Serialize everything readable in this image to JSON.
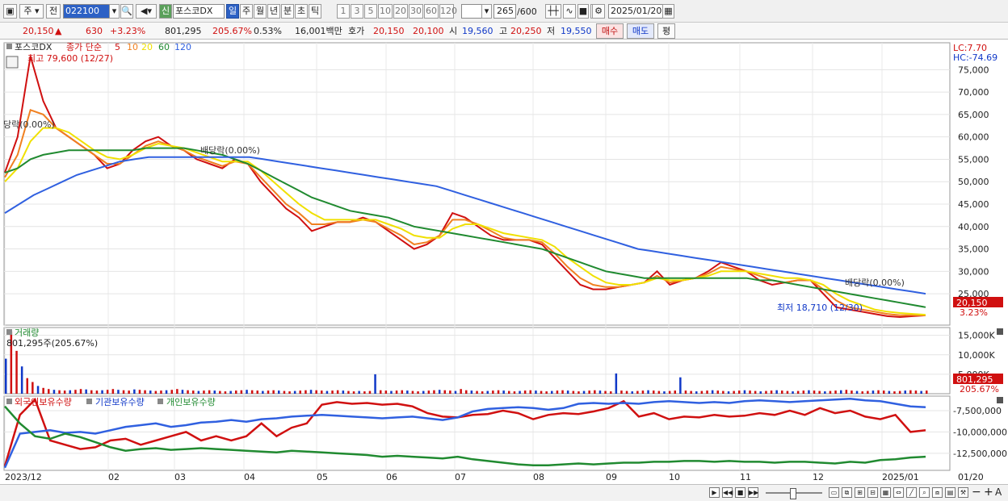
{
  "toolbar": {
    "period_day": "주",
    "prev_label": "전",
    "code": "022100",
    "new_badge": "신",
    "stock_name": "포스코DX",
    "periods": [
      "일",
      "주",
      "월",
      "년",
      "분",
      "초",
      "틱"
    ],
    "selected_period": "일",
    "intervals": [
      "1",
      "3",
      "5",
      "10",
      "20",
      "30",
      "60",
      "120"
    ],
    "count": "265",
    "count_total": "/600",
    "date": "2025/01/20"
  },
  "quote": {
    "price": "20,150",
    "change": "630",
    "change_pct": "+3.23%",
    "volume": "801,295",
    "volume_ratio": "205.67%",
    "turnover": "0.53%",
    "amount": "16,001백만",
    "bid_label": "호가",
    "bid1": "20,150",
    "bid2": "20,100",
    "open_label": "시",
    "open": "19,560",
    "high_label": "고",
    "high": "20,250",
    "low_label": "저",
    "low": "19,550",
    "buy_label": "매수",
    "sell_label": "매도",
    "eval_label": "평"
  },
  "legend": {
    "name": "포스코DX",
    "ma_title": "종가 단순",
    "ma_periods": [
      "5",
      "10",
      "20",
      "60",
      "120"
    ],
    "ma_colors": [
      "#d01010",
      "#f08020",
      "#f0e000",
      "#208a30",
      "#3060e0"
    ],
    "lc": "LC:7.70",
    "hc": "HC:-74.69"
  },
  "annotations": {
    "high_text": "최고 79,600 (12/27)",
    "low_text": "최저 18,710 (12/30)",
    "div1": "당락(0.00%)",
    "div2": "배당락(0.00%)",
    "div3": "배당락(0.00%)",
    "price_tag": "20,150",
    "price_pct_tag": "3.23%"
  },
  "volume_panel": {
    "title": "거래량",
    "value_text": "801,295주(205.67%)",
    "tag_value": "801,295",
    "tag_pct": "205.67%"
  },
  "holdings_panel": {
    "titles": [
      "외국인보유수량",
      "기관보유수량",
      "개인보유수량"
    ]
  },
  "chart_data": [
    {
      "type": "line",
      "title": "포스코DX",
      "x_ticks": [
        "2023/12",
        "02",
        "03",
        "04",
        "05",
        "06",
        "07",
        "08",
        "09",
        "10",
        "11",
        "12",
        "2025/01",
        "01/20"
      ],
      "y_ticks": [
        75000,
        70000,
        65000,
        60000,
        55000,
        50000,
        45000,
        40000,
        35000,
        30000,
        25000
      ],
      "ylim": [
        18000,
        81000
      ],
      "series": [
        {
          "name": "5",
          "color": "#d01010",
          "values": [
            52000,
            60000,
            78000,
            68000,
            62000,
            60000,
            58000,
            56000,
            53000,
            54000,
            57000,
            59000,
            60000,
            58000,
            57000,
            55000,
            54000,
            53000,
            55000,
            54000,
            50000,
            47000,
            44000,
            42000,
            39000,
            40000,
            41000,
            41000,
            42000,
            41000,
            39000,
            37000,
            35000,
            36000,
            38000,
            43000,
            42000,
            40000,
            38000,
            37000,
            37000,
            37000,
            36000,
            33000,
            30000,
            27000,
            26000,
            26000,
            26500,
            27000,
            27500,
            30000,
            27000,
            28000,
            28500,
            30000,
            32000,
            31000,
            30000,
            28000,
            27000,
            27500,
            28000,
            28000,
            25000,
            22000,
            21500,
            21000,
            20500,
            20000,
            19800,
            20000,
            20200
          ]
        },
        {
          "name": "10",
          "color": "#f08020",
          "values": [
            51000,
            56000,
            66000,
            65000,
            62000,
            60000,
            58000,
            56000,
            54000,
            54000,
            56000,
            58000,
            59000,
            58000,
            57000,
            55500,
            54500,
            53500,
            54500,
            54000,
            51000,
            48000,
            45000,
            43000,
            40500,
            40500,
            41000,
            41000,
            41500,
            41000,
            39500,
            38000,
            36000,
            36500,
            38000,
            41500,
            41500,
            40500,
            39000,
            37500,
            37000,
            37000,
            36500,
            34000,
            31000,
            28500,
            27000,
            26500,
            26500,
            27000,
            27500,
            29000,
            27500,
            28000,
            28500,
            29500,
            31000,
            30500,
            30000,
            29000,
            28000,
            27500,
            28000,
            28000,
            26000,
            23500,
            22000,
            21500,
            21000,
            20500,
            20200,
            20200,
            20200
          ]
        },
        {
          "name": "20",
          "color": "#f0e000",
          "values": [
            50000,
            53000,
            59000,
            62000,
            62000,
            61000,
            59000,
            57000,
            55500,
            55000,
            56000,
            57500,
            58500,
            58000,
            57500,
            56500,
            55500,
            54500,
            54500,
            54500,
            52500,
            50000,
            47500,
            45000,
            43000,
            41500,
            41500,
            41500,
            41500,
            41500,
            40500,
            39500,
            38000,
            37500,
            37500,
            39500,
            40500,
            40500,
            39500,
            38500,
            38000,
            37500,
            37000,
            35500,
            33000,
            31000,
            29000,
            27500,
            27000,
            27000,
            27500,
            28500,
            28000,
            28000,
            28500,
            29000,
            30000,
            30000,
            30000,
            29500,
            29000,
            28500,
            28500,
            28000,
            27000,
            25000,
            23500,
            22500,
            21500,
            21000,
            20700,
            20500,
            20300
          ]
        },
        {
          "name": "60",
          "color": "#208a30",
          "values": [
            52000,
            53000,
            55000,
            56000,
            56500,
            57000,
            57000,
            57000,
            57000,
            57000,
            57000,
            57500,
            57500,
            57500,
            57500,
            57000,
            56500,
            56000,
            55000,
            54000,
            52500,
            51000,
            49500,
            48000,
            46500,
            45500,
            44500,
            43500,
            43000,
            42500,
            42000,
            41000,
            40000,
            39500,
            39000,
            38500,
            38000,
            37500,
            37000,
            36500,
            36000,
            35500,
            35000,
            34000,
            33000,
            32000,
            31000,
            30000,
            29500,
            29000,
            28500,
            28500,
            28500,
            28500,
            28500,
            28500,
            28500,
            28500,
            28500,
            28000,
            28000,
            27500,
            27000,
            26500,
            26000,
            25500,
            25000,
            24500,
            24000,
            23500,
            23000,
            22500,
            22000
          ]
        },
        {
          "name": "120",
          "color": "#3060e0",
          "values": [
            43000,
            45000,
            47000,
            48500,
            50000,
            51500,
            52500,
            53500,
            54500,
            55000,
            55500,
            55500,
            55500,
            55500,
            55500,
            55500,
            55500,
            55500,
            55000,
            54500,
            54000,
            53500,
            53000,
            52500,
            52000,
            51500,
            51000,
            50500,
            50000,
            49500,
            49000,
            48000,
            47000,
            46000,
            45000,
            44000,
            43000,
            42000,
            41000,
            40000,
            39000,
            38000,
            37000,
            36000,
            35000,
            34500,
            34000,
            33500,
            33000,
            32500,
            32000,
            31500,
            31000,
            30500,
            30000,
            29500,
            29000,
            28500,
            28000,
            27500,
            27000,
            26500,
            26000,
            25500,
            25000
          ]
        }
      ]
    },
    {
      "type": "bar",
      "title": "거래량",
      "y_ticks": [
        "15,000K",
        "10,000K",
        "5,000K"
      ],
      "ylim": [
        0,
        17000
      ],
      "unit": "K",
      "values": [
        9000,
        16000,
        11000,
        7000,
        4000,
        3000,
        2000,
        1500,
        1200,
        1000,
        900,
        800,
        900,
        1000,
        1200,
        1100,
        900,
        800,
        900,
        1000,
        1200,
        1000,
        900,
        800,
        1100,
        1000,
        900,
        800,
        700,
        800,
        900,
        1000,
        1200,
        1000,
        900,
        800,
        700,
        800,
        900,
        800,
        700,
        600,
        700,
        800,
        900,
        1000,
        900,
        800,
        700,
        800,
        900,
        800,
        700,
        600,
        700,
        800,
        900,
        1000,
        900,
        800,
        700,
        800,
        900,
        800,
        700,
        600,
        700,
        600,
        700,
        5000,
        900,
        800,
        700,
        800,
        900,
        800,
        700,
        600,
        700,
        800,
        900,
        1000,
        900,
        800,
        700,
        1200,
        900,
        800,
        700,
        600,
        700,
        800,
        900,
        800,
        700,
        600,
        700,
        800,
        900,
        800,
        700,
        600,
        700,
        800,
        900,
        800,
        700,
        600,
        700,
        800,
        900,
        800,
        700,
        600,
        5200,
        800,
        700,
        600,
        700,
        800,
        900,
        800,
        700,
        600,
        700,
        800,
        4200,
        800,
        700,
        600,
        700,
        800,
        900,
        800,
        700,
        600,
        700,
        800,
        900,
        800,
        700,
        600,
        700,
        800,
        900,
        800,
        700,
        600,
        700,
        800,
        900,
        800,
        700,
        600,
        700,
        800,
        900,
        1000,
        800,
        700,
        600,
        700,
        800,
        900,
        800,
        700,
        600,
        700,
        800,
        900,
        800,
        700,
        800
      ]
    },
    {
      "type": "line",
      "title": "외국인보유수량",
      "y_ticks": [
        "-7,500,000",
        "-10,000,000",
        "-12,500,000"
      ],
      "ylim": [
        -14500000,
        -5800000
      ],
      "series": [
        {
          "name": "외국인보유수량",
          "color": "#d01010",
          "values": [
            -14000000,
            -8000000,
            -6200000,
            -11000000,
            -11500000,
            -12000000,
            -11800000,
            -11000000,
            -10800000,
            -11500000,
            -11000000,
            -10500000,
            -10000000,
            -11000000,
            -10500000,
            -11000000,
            -10500000,
            -9000000,
            -10500000,
            -9500000,
            -9000000,
            -6800000,
            -6500000,
            -6700000,
            -6600000,
            -6800000,
            -6700000,
            -7000000,
            -7800000,
            -8200000,
            -8300000,
            -8000000,
            -7900000,
            -7500000,
            -7800000,
            -8500000,
            -8000000,
            -7800000,
            -7900000,
            -7600000,
            -7200000,
            -6400000,
            -8200000,
            -7800000,
            -8500000,
            -8200000,
            -8300000,
            -8000000,
            -8200000,
            -8100000,
            -7800000,
            -8000000,
            -7500000,
            -8000000,
            -7200000,
            -7800000,
            -7500000,
            -8200000,
            -8500000,
            -8000000,
            -10000000,
            -9800000
          ]
        },
        {
          "name": "기관보유수량",
          "color": "#3060e0",
          "values": [
            -14200000,
            -10200000,
            -10000000,
            -9800000,
            -10100000,
            -10000000,
            -10200000,
            -9800000,
            -9400000,
            -9200000,
            -9000000,
            -9400000,
            -9200000,
            -8900000,
            -8800000,
            -8600000,
            -8800000,
            -8500000,
            -8400000,
            -8200000,
            -8100000,
            -8000000,
            -8100000,
            -8200000,
            -8300000,
            -8400000,
            -8300000,
            -8200000,
            -8400000,
            -8600000,
            -8300000,
            -7600000,
            -7300000,
            -7200000,
            -7100000,
            -7200000,
            -7400000,
            -7200000,
            -6700000,
            -6600000,
            -6700000,
            -6600000,
            -6700000,
            -6500000,
            -6400000,
            -6500000,
            -6600000,
            -6500000,
            -6600000,
            -6400000,
            -6300000,
            -6400000,
            -6500000,
            -6400000,
            -6300000,
            -6200000,
            -6100000,
            -6300000,
            -6400000,
            -6700000,
            -7000000,
            -7100000
          ]
        },
        {
          "name": "개인보유수량",
          "color": "#208a30",
          "values": [
            -7000000,
            -9000000,
            -10500000,
            -10800000,
            -10200000,
            -10600000,
            -11200000,
            -11800000,
            -12200000,
            -12000000,
            -11900000,
            -12100000,
            -12000000,
            -11900000,
            -12000000,
            -12100000,
            -12200000,
            -12300000,
            -12400000,
            -12200000,
            -12300000,
            -12400000,
            -12500000,
            -12600000,
            -12700000,
            -12900000,
            -12800000,
            -12900000,
            -13000000,
            -13100000,
            -12900000,
            -13200000,
            -13400000,
            -13600000,
            -13800000,
            -13900000,
            -13900000,
            -13800000,
            -13700000,
            -13800000,
            -13700000,
            -13600000,
            -13600000,
            -13500000,
            -13500000,
            -13400000,
            -13400000,
            -13500000,
            -13400000,
            -13500000,
            -13500000,
            -13600000,
            -13500000,
            -13500000,
            -13600000,
            -13700000,
            -13500000,
            -13600000,
            -13300000,
            -13200000,
            -13000000,
            -12900000
          ]
        }
      ]
    }
  ]
}
